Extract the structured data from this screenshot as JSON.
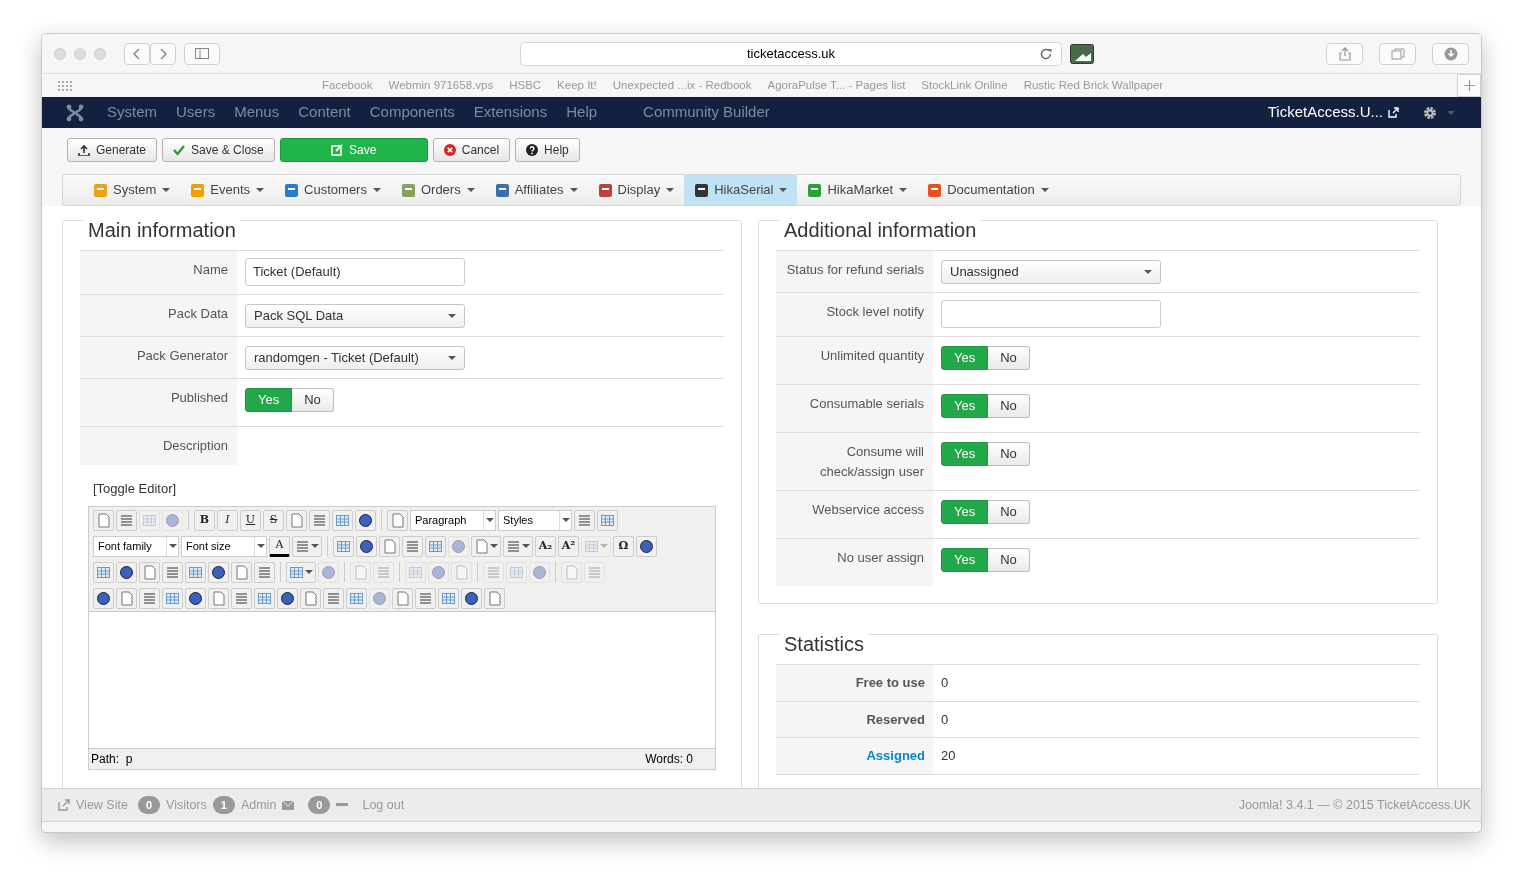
{
  "browser": {
    "address": "ticketaccess.uk",
    "bookmarks": [
      "Facebook",
      "Webmin 971658.vps",
      "HSBC",
      "Keep It!",
      "Unexpected ...ix - Redbook",
      "AgoraPulse T... - Pages list",
      "StockLink Online",
      "Rustic Red Brick Wallpaper"
    ]
  },
  "admin_menu": {
    "items": [
      "System",
      "Users",
      "Menus",
      "Content",
      "Components",
      "Extensions",
      "Help",
      "Community Builder"
    ],
    "site_link": "TicketAccess.U..."
  },
  "toolbar": [
    {
      "label": "Generate",
      "kind": "generate"
    },
    {
      "label": "Save & Close",
      "kind": "save_close"
    },
    {
      "label": "Save",
      "kind": "save"
    },
    {
      "label": "Cancel",
      "kind": "cancel"
    },
    {
      "label": "Help",
      "kind": "help"
    }
  ],
  "component_menu": [
    {
      "label": "System",
      "selected": false
    },
    {
      "label": "Events",
      "selected": false
    },
    {
      "label": "Customers",
      "selected": false
    },
    {
      "label": "Orders",
      "selected": false
    },
    {
      "label": "Affiliates",
      "selected": false
    },
    {
      "label": "Display",
      "selected": false
    },
    {
      "label": "HikaSerial",
      "selected": true
    },
    {
      "label": "HikaMarket",
      "selected": false
    },
    {
      "label": "Documentation",
      "selected": false
    }
  ],
  "main_information": {
    "title": "Main information",
    "rows": [
      {
        "label": "Name",
        "kind": "text",
        "value": "Ticket (Default)"
      },
      {
        "label": "Pack Data",
        "kind": "select",
        "value": "Pack SQL Data"
      },
      {
        "label": "Pack Generator",
        "kind": "select",
        "value": "randomgen - Ticket (Default)"
      },
      {
        "label": "Published",
        "kind": "toggle",
        "options": [
          {
            "label": "Yes",
            "selected": true
          },
          {
            "label": "No",
            "selected": false
          }
        ]
      },
      {
        "label": "Description",
        "kind": "empty"
      }
    ]
  },
  "editor": {
    "toggle_link": "[Toggle Editor]",
    "toolbar_rows": [
      [
        {
          "kind": "icon",
          "disabled": false
        },
        {
          "kind": "icon",
          "disabled": false
        },
        {
          "kind": "icon",
          "disabled": true
        },
        {
          "kind": "icon",
          "disabled": true
        },
        {
          "kind": "separator"
        },
        {
          "kind": "letter",
          "label": "B",
          "disabled": false
        },
        {
          "kind": "letter",
          "label": "I",
          "disabled": false
        },
        {
          "kind": "letter",
          "label": "U",
          "disabled": false
        },
        {
          "kind": "letter",
          "label": "S",
          "disabled": false
        },
        {
          "kind": "icon",
          "disabled": false
        },
        {
          "kind": "icon",
          "disabled": false
        },
        {
          "kind": "icon",
          "disabled": false
        },
        {
          "kind": "icon",
          "disabled": false
        },
        {
          "kind": "separator"
        },
        {
          "kind": "icon",
          "disabled": false
        },
        {
          "kind": "select",
          "label": "Paragraph"
        },
        {
          "kind": "select",
          "label": "Styles"
        },
        {
          "kind": "icon",
          "disabled": false
        },
        {
          "kind": "icon",
          "disabled": false
        }
      ],
      [
        {
          "kind": "select",
          "label": "Font family"
        },
        {
          "kind": "select",
          "label": "Font size"
        },
        {
          "kind": "color",
          "label": "A",
          "disabled": false
        },
        {
          "kind": "split",
          "disabled": false
        },
        {
          "kind": "separator"
        },
        {
          "kind": "icon",
          "disabled": false
        },
        {
          "kind": "icon",
          "disabled": false
        },
        {
          "kind": "icon",
          "disabled": false
        },
        {
          "kind": "icon",
          "disabled": false
        },
        {
          "kind": "icon",
          "disabled": false
        },
        {
          "kind": "icon",
          "disabled": true
        },
        {
          "kind": "split",
          "disabled": false
        },
        {
          "kind": "split",
          "disabled": false
        },
        {
          "kind": "letter",
          "label": "A₂",
          "disabled": false
        },
        {
          "kind": "letter",
          "label": "A²",
          "disabled": false
        },
        {
          "kind": "split",
          "disabled": true
        },
        {
          "kind": "letter",
          "label": "Ω",
          "disabled": false
        },
        {
          "kind": "icon",
          "disabled": false
        }
      ],
      [
        {
          "kind": "icon",
          "disabled": false
        },
        {
          "kind": "icon",
          "disabled": false
        },
        {
          "kind": "icon",
          "disabled": false
        },
        {
          "kind": "icon",
          "disabled": false
        },
        {
          "kind": "icon",
          "disabled": false
        },
        {
          "kind": "icon",
          "disabled": false
        },
        {
          "kind": "icon",
          "disabled": false
        },
        {
          "kind": "icon",
          "disabled": false
        },
        {
          "kind": "separator"
        },
        {
          "kind": "split",
          "disabled": false
        },
        {
          "kind": "icon",
          "disabled": true
        },
        {
          "kind": "separator"
        },
        {
          "kind": "icon",
          "disabled": true
        },
        {
          "kind": "icon",
          "disabled": true
        },
        {
          "kind": "separator"
        },
        {
          "kind": "icon",
          "disabled": true
        },
        {
          "kind": "icon",
          "disabled": true
        },
        {
          "kind": "icon",
          "disabled": true
        },
        {
          "kind": "separator"
        },
        {
          "kind": "icon",
          "disabled": true
        },
        {
          "kind": "icon",
          "disabled": true
        },
        {
          "kind": "icon",
          "disabled": true
        },
        {
          "kind": "separator"
        },
        {
          "kind": "icon",
          "disabled": true
        },
        {
          "kind": "icon",
          "disabled": true
        }
      ],
      [
        {
          "kind": "icon",
          "disabled": false
        },
        {
          "kind": "icon",
          "disabled": false
        },
        {
          "kind": "icon",
          "disabled": false
        },
        {
          "kind": "icon",
          "disabled": false
        },
        {
          "kind": "icon",
          "disabled": false
        },
        {
          "kind": "icon",
          "disabled": false
        },
        {
          "kind": "icon",
          "disabled": false
        },
        {
          "kind": "icon",
          "disabled": false
        },
        {
          "kind": "icon",
          "disabled": false
        },
        {
          "kind": "icon",
          "disabled": false
        },
        {
          "kind": "icon",
          "disabled": false
        },
        {
          "kind": "icon",
          "disabled": false
        },
        {
          "kind": "icon",
          "disabled": true
        },
        {
          "kind": "icon",
          "disabled": false
        },
        {
          "kind": "icon",
          "disabled": false
        },
        {
          "kind": "icon",
          "disabled": false
        },
        {
          "kind": "icon",
          "disabled": false
        },
        {
          "kind": "icon",
          "disabled": false
        }
      ]
    ],
    "path": "Path:  p",
    "words": "Words: 0"
  },
  "additional_information": {
    "title": "Additional information",
    "rows": [
      {
        "label": "Status for refund serials",
        "kind": "select",
        "value": "Unassigned"
      },
      {
        "label": "Stock level notify",
        "kind": "text",
        "value": ""
      },
      {
        "label": "Unlimited quantity",
        "kind": "toggle",
        "options": [
          {
            "label": "Yes",
            "selected": true
          },
          {
            "label": "No",
            "selected": false
          }
        ]
      },
      {
        "label": "Consumable serials",
        "kind": "toggle",
        "options": [
          {
            "label": "Yes",
            "selected": true
          },
          {
            "label": "No",
            "selected": false
          }
        ]
      },
      {
        "label": "Consume will check/assign user",
        "kind": "toggle",
        "options": [
          {
            "label": "Yes",
            "selected": true
          },
          {
            "label": "No",
            "selected": false
          }
        ]
      },
      {
        "label": "Webservice access",
        "kind": "toggle",
        "options": [
          {
            "label": "Yes",
            "selected": true
          },
          {
            "label": "No",
            "selected": false
          }
        ]
      },
      {
        "label": "No user assign",
        "kind": "toggle",
        "options": [
          {
            "label": "Yes",
            "selected": true
          },
          {
            "label": "No",
            "selected": false
          }
        ]
      }
    ]
  },
  "statistics": {
    "title": "Statistics",
    "rows": [
      {
        "label": "Free to use",
        "value": "0",
        "link": false
      },
      {
        "label": "Reserved",
        "value": "0",
        "link": false
      },
      {
        "label": "Assigned",
        "value": "20",
        "link": true
      }
    ]
  },
  "status_bar": {
    "view_site": "View Site",
    "visitors_count": "0",
    "visitors": "Visitors",
    "admin_count": "1",
    "admin": "Admin",
    "messages_count": "0",
    "logout": "Log out",
    "version": "Joomla! 3.4.1 — © 2015 TicketAccess.UK"
  }
}
